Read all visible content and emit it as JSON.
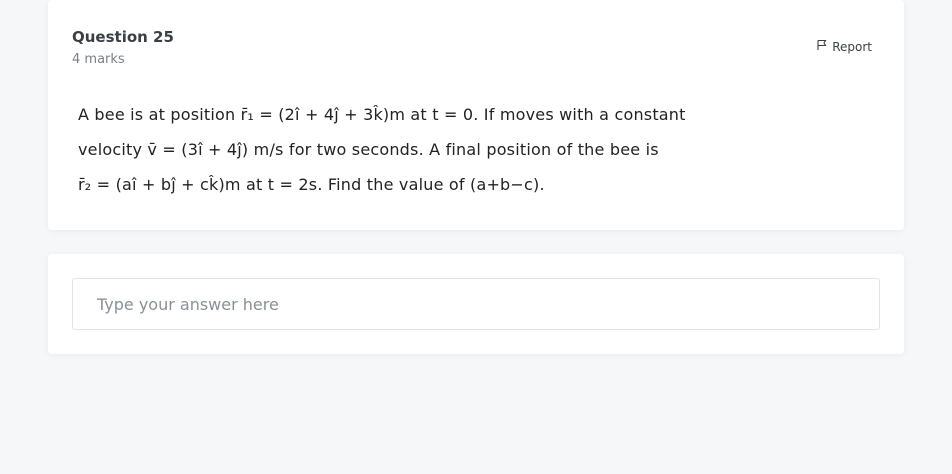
{
  "question": {
    "title": "Question 25",
    "marks": "4 marks",
    "report_label": "Report",
    "text_lines": [
      "A bee is at position r̄₁ = (2î + 4ĵ + 3k̂)m  at t = 0. If moves with a constant",
      "velocity  v̄ = (3î + 4ĵ) m/s  for two seconds. A final position of the bee is",
      "r̄₂ = (aî + bĵ + ck̂)m  at t = 2s. Find the value of (a+b−c)."
    ]
  },
  "answer": {
    "placeholder": "Type your answer here",
    "value": ""
  },
  "icons": {
    "report": "flag-icon"
  },
  "colors": {
    "background": "#f6f7f8",
    "card": "#ffffff",
    "border": "#dfe3e8"
  }
}
